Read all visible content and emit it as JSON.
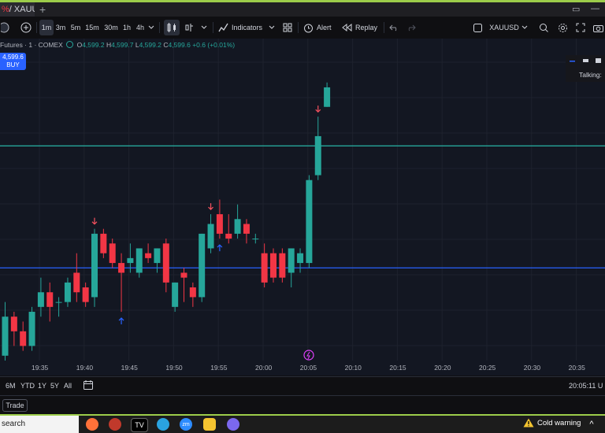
{
  "tab": {
    "title_red": "%",
    "title": " / XAUU"
  },
  "toolbar": {
    "intervals": [
      "1m",
      "3m",
      "5m",
      "15m",
      "30m",
      "1h",
      "4h"
    ],
    "active_interval": "1m",
    "indicators_label": "Indicators",
    "alert_label": "Alert",
    "replay_label": "Replay",
    "symbol": "XAUUSD"
  },
  "legend": {
    "name": "Futures · 1 · COMEX",
    "open_label": "O",
    "open": "4,599.2",
    "high_label": "H",
    "high": "4,599.7",
    "low_label": "L",
    "low": "4,599.2",
    "close_label": "C",
    "close": "4,599.6",
    "change": "+0.6 (+0.01%)"
  },
  "buy": {
    "price": "4,599.6",
    "label": "BUY"
  },
  "panel": {
    "talking": "Talking:"
  },
  "chart_data": {
    "type": "candlestick",
    "x_ticks": [
      "19:35",
      "19:40",
      "19:45",
      "19:50",
      "19:55",
      "20:00",
      "20:05",
      "20:10",
      "20:15",
      "20:20",
      "20:25",
      "20:30",
      "20:35"
    ],
    "y_range": [
      4594.0,
      4600.6
    ],
    "bullish_color": "#26a69a",
    "bearish_color": "#f23645",
    "hlines": [
      {
        "price": 4598.4,
        "color": "#26a69a"
      },
      {
        "price": 4595.9,
        "color": "#2962ff"
      }
    ],
    "candles": [
      {
        "o": 4594.1,
        "h": 4595.2,
        "l": 4594.0,
        "c": 4594.9
      },
      {
        "o": 4594.9,
        "h": 4595.0,
        "l": 4594.3,
        "c": 4594.6
      },
      {
        "o": 4594.6,
        "h": 4594.8,
        "l": 4594.2,
        "c": 4594.3
      },
      {
        "o": 4594.3,
        "h": 4595.1,
        "l": 4594.2,
        "c": 4595.0
      },
      {
        "o": 4595.1,
        "h": 4595.7,
        "l": 4594.9,
        "c": 4595.4
      },
      {
        "o": 4595.4,
        "h": 4595.6,
        "l": 4594.8,
        "c": 4595.1
      },
      {
        "o": 4595.2,
        "h": 4595.3,
        "l": 4594.9,
        "c": 4595.2
      },
      {
        "o": 4595.2,
        "h": 4595.7,
        "l": 4595.1,
        "c": 4595.6
      },
      {
        "o": 4595.8,
        "h": 4596.2,
        "l": 4595.2,
        "c": 4595.4
      },
      {
        "o": 4595.5,
        "h": 4595.6,
        "l": 4595.1,
        "c": 4595.2
      },
      {
        "o": 4595.3,
        "h": 4596.7,
        "l": 4595.1,
        "c": 4596.6
      },
      {
        "o": 4596.6,
        "h": 4596.7,
        "l": 4596.1,
        "c": 4596.2
      },
      {
        "o": 4596.4,
        "h": 4596.5,
        "l": 4595.9,
        "c": 4596.0
      },
      {
        "o": 4596.0,
        "h": 4596.2,
        "l": 4595.0,
        "c": 4595.8
      },
      {
        "o": 4596.0,
        "h": 4596.4,
        "l": 4595.8,
        "c": 4596.1
      },
      {
        "o": 4595.8,
        "h": 4596.3,
        "l": 4595.7,
        "c": 4596.3
      },
      {
        "o": 4596.2,
        "h": 4596.4,
        "l": 4596.0,
        "c": 4596.1
      },
      {
        "o": 4596.0,
        "h": 4596.3,
        "l": 4595.8,
        "c": 4596.3
      },
      {
        "o": 4596.4,
        "h": 4596.5,
        "l": 4595.4,
        "c": 4595.6
      },
      {
        "o": 4595.1,
        "h": 4595.6,
        "l": 4595.0,
        "c": 4595.6
      },
      {
        "o": 4595.8,
        "h": 4595.9,
        "l": 4595.2,
        "c": 4595.7
      },
      {
        "o": 4595.5,
        "h": 4595.6,
        "l": 4595.1,
        "c": 4595.3
      },
      {
        "o": 4595.3,
        "h": 4596.6,
        "l": 4595.2,
        "c": 4596.6
      },
      {
        "o": 4596.3,
        "h": 4597.0,
        "l": 4596.2,
        "c": 4596.8
      },
      {
        "o": 4597.0,
        "h": 4597.3,
        "l": 4596.5,
        "c": 4596.6
      },
      {
        "o": 4596.6,
        "h": 4597.0,
        "l": 4596.4,
        "c": 4596.5
      },
      {
        "o": 4596.6,
        "h": 4597.2,
        "l": 4596.5,
        "c": 4596.9
      },
      {
        "o": 4596.8,
        "h": 4596.9,
        "l": 4596.4,
        "c": 4596.6
      },
      {
        "o": 4596.5,
        "h": 4596.6,
        "l": 4596.4,
        "c": 4596.5
      },
      {
        "o": 4596.2,
        "h": 4596.4,
        "l": 4595.5,
        "c": 4595.6
      },
      {
        "o": 4596.2,
        "h": 4596.3,
        "l": 4595.6,
        "c": 4595.7
      },
      {
        "o": 4596.2,
        "h": 4596.3,
        "l": 4595.6,
        "c": 4595.7
      },
      {
        "o": 4595.8,
        "h": 4596.3,
        "l": 4595.5,
        "c": 4596.3
      },
      {
        "o": 4596.0,
        "h": 4596.3,
        "l": 4595.8,
        "c": 4596.2
      },
      {
        "o": 4596.0,
        "h": 4597.8,
        "l": 4595.9,
        "c": 4597.7
      },
      {
        "o": 4597.8,
        "h": 4599.0,
        "l": 4597.7,
        "c": 4598.6
      },
      {
        "o": 4599.2,
        "h": 4599.7,
        "l": 4599.2,
        "c": 4599.6
      }
    ],
    "markers": [
      {
        "candle": 10,
        "dir": "down",
        "side": "above"
      },
      {
        "candle": 13,
        "dir": "up",
        "side": "below"
      },
      {
        "candle": 23,
        "dir": "down",
        "side": "above"
      },
      {
        "candle": 24,
        "dir": "up",
        "side": "below"
      },
      {
        "candle": 35,
        "dir": "down",
        "side": "above"
      }
    ]
  },
  "range": {
    "items": [
      "6M",
      "YTD",
      "1Y",
      "5Y",
      "All"
    ],
    "clock": "20:05:11 U"
  },
  "trade": {
    "label": "Trade"
  },
  "taskbar": {
    "search": "search",
    "weather": "Cold warning"
  }
}
